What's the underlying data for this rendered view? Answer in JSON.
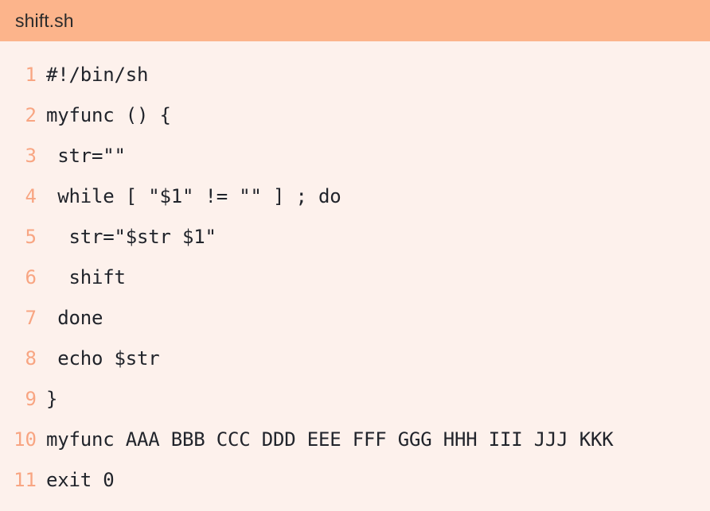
{
  "titlebar": {
    "filename": "shift.sh",
    "background_color": "#fcb48b",
    "text_color": "#2b2b2b"
  },
  "editor": {
    "background_color": "#fdf1ec",
    "code_color": "#21242b",
    "line_number_color": "#f8a582",
    "lines": [
      {
        "number": "1",
        "text": "#!/bin/sh"
      },
      {
        "number": "2",
        "text": "myfunc () {"
      },
      {
        "number": "3",
        "text": " str=\"\""
      },
      {
        "number": "4",
        "text": " while [ \"$1\" != \"\" ] ; do"
      },
      {
        "number": "5",
        "text": "  str=\"$str $1\""
      },
      {
        "number": "6",
        "text": "  shift"
      },
      {
        "number": "7",
        "text": " done"
      },
      {
        "number": "8",
        "text": " echo $str"
      },
      {
        "number": "9",
        "text": "}"
      },
      {
        "number": "10",
        "text": "myfunc AAA BBB CCC DDD EEE FFF GGG HHH III JJJ KKK"
      },
      {
        "number": "11",
        "text": "exit 0"
      }
    ]
  }
}
